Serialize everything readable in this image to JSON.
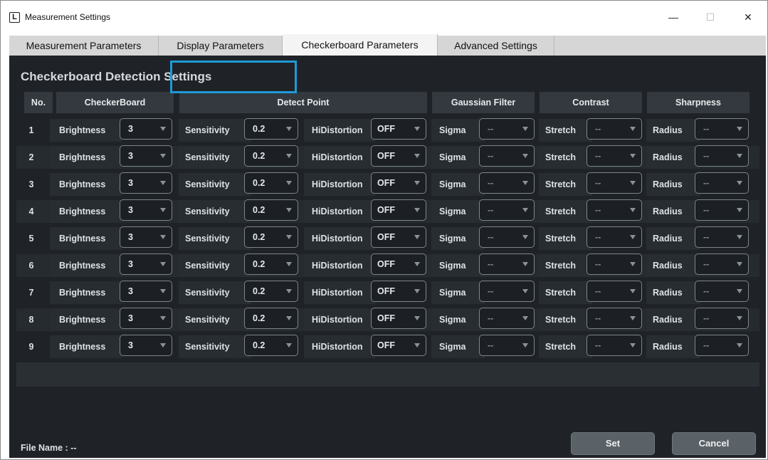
{
  "window": {
    "title": "Measurement Settings",
    "logo_letter": "L",
    "minimize": "—",
    "maximize": "☐",
    "close": "✕"
  },
  "tabs": [
    {
      "label": "Measurement Parameters"
    },
    {
      "label": "Display Parameters"
    },
    {
      "label": "Checkerboard Parameters",
      "active": true
    },
    {
      "label": "Advanced Settings"
    }
  ],
  "section_title": "Checkerboard Detection Settings",
  "headers": {
    "no": "No.",
    "checkerboard": "CheckerBoard",
    "detect_point": "Detect Point",
    "gaussian": "Gaussian Filter",
    "contrast": "Contrast",
    "sharpness": "Sharpness"
  },
  "labels": {
    "brightness": "Brightness",
    "sensitivity": "Sensitivity",
    "hidistortion": "HiDistortion",
    "sigma": "Sigma",
    "stretch": "Stretch",
    "radius": "Radius"
  },
  "rows": [
    {
      "no": "1",
      "brightness": "3",
      "sensitivity": "0.2",
      "hidistortion": "OFF",
      "sigma": "--",
      "stretch": "--",
      "radius": "--"
    },
    {
      "no": "2",
      "brightness": "3",
      "sensitivity": "0.2",
      "hidistortion": "OFF",
      "sigma": "--",
      "stretch": "--",
      "radius": "--"
    },
    {
      "no": "3",
      "brightness": "3",
      "sensitivity": "0.2",
      "hidistortion": "OFF",
      "sigma": "--",
      "stretch": "--",
      "radius": "--"
    },
    {
      "no": "4",
      "brightness": "3",
      "sensitivity": "0.2",
      "hidistortion": "OFF",
      "sigma": "--",
      "stretch": "--",
      "radius": "--"
    },
    {
      "no": "5",
      "brightness": "3",
      "sensitivity": "0.2",
      "hidistortion": "OFF",
      "sigma": "--",
      "stretch": "--",
      "radius": "--"
    },
    {
      "no": "6",
      "brightness": "3",
      "sensitivity": "0.2",
      "hidistortion": "OFF",
      "sigma": "--",
      "stretch": "--",
      "radius": "--"
    },
    {
      "no": "7",
      "brightness": "3",
      "sensitivity": "0.2",
      "hidistortion": "OFF",
      "sigma": "--",
      "stretch": "--",
      "radius": "--"
    },
    {
      "no": "8",
      "brightness": "3",
      "sensitivity": "0.2",
      "hidistortion": "OFF",
      "sigma": "--",
      "stretch": "--",
      "radius": "--"
    },
    {
      "no": "9",
      "brightness": "3",
      "sensitivity": "0.2",
      "hidistortion": "OFF",
      "sigma": "--",
      "stretch": "--",
      "radius": "--"
    }
  ],
  "footer": {
    "file_name": "File Name :  --",
    "set_label": "Set",
    "cancel_label": "Cancel"
  },
  "colors": {
    "highlight": "#1e9ad7",
    "panel": "#1f2327",
    "header": "#33393e"
  }
}
